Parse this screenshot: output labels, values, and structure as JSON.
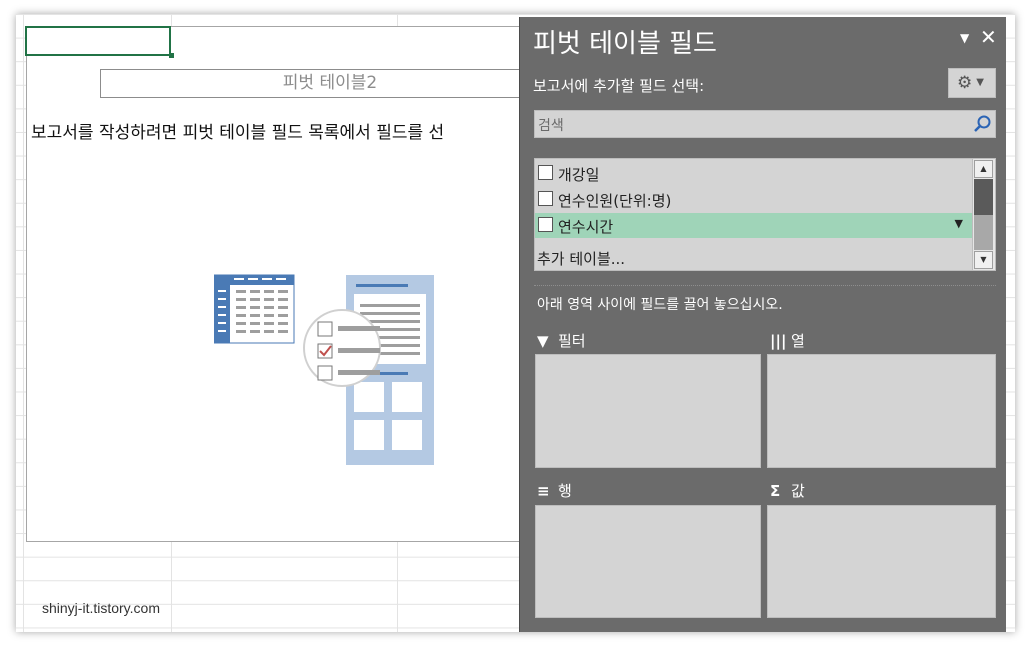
{
  "sheet": {
    "pivot_table_name": "피벗 테이블2",
    "instruction": "보고서를 작성하려면 피벗 테이블 필드 목록에서 필드를 선",
    "watermark": "shinyj-it.tistory.com"
  },
  "pane": {
    "title": "피벗 테이블 필드",
    "choose_fields_label": "보고서에 추가할 필드 선택:",
    "settings_icon": "gear-icon",
    "search_placeholder": "검색",
    "search_icon": "search-icon",
    "fields": [
      {
        "label": "개강일",
        "checked": false
      },
      {
        "label": "연수인원(단위:명)",
        "checked": false
      },
      {
        "label": "연수시간",
        "checked": false
      }
    ],
    "more_tables": "추가 테이블...",
    "drag_instruction": "아래 영역 사이에 필드를 끌어 놓으십시오.",
    "areas": {
      "filters": "필터",
      "columns": "열",
      "rows": "행",
      "values": "값"
    }
  },
  "colors": {
    "pane_bg": "#6b6b6b",
    "highlight": "#9fd4b8",
    "selection": "#217346",
    "illustration_blue": "#4a7ab5"
  }
}
